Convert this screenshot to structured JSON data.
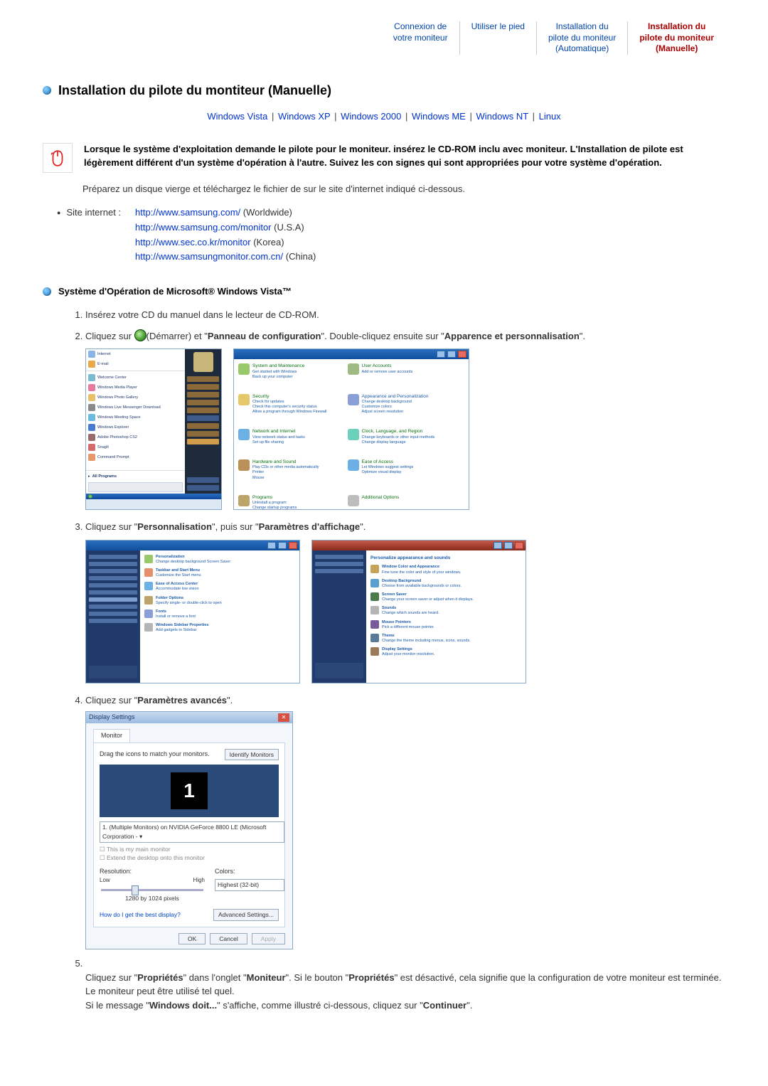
{
  "topnav": {
    "item1": "Connexion de\nvotre moniteur",
    "item2": "Utiliser le pied",
    "item3": "Installation du\npilote du moniteur\n(Automatique)",
    "item4": "Installation du\npilote du moniteur\n(Manuelle)"
  },
  "title": "Installation du pilote du montiteur (Manuelle)",
  "os_links": {
    "vista": "Windows Vista",
    "xp": "Windows XP",
    "w2000": "Windows 2000",
    "me": "Windows ME",
    "nt": "Windows NT",
    "linux": "Linux",
    "sep": "|"
  },
  "intro": "Lorsque le système d'exploitation demande le pilote pour le moniteur. insérez le CD-ROM inclu avec moniteur. L'Installation de pilote est légèrement différent d'un système d'opération à l'autre. Suivez les con signes qui sont appropriées pour votre système d'opération.",
  "prepare": "Préparez un disque vierge et téléchargez le fichier de sur le site d'internet indiqué ci-dessous.",
  "site_label": "Site internet :",
  "sites": {
    "worldwide_url": "http://www.samsung.com/",
    "worldwide_loc": " (Worldwide)",
    "usa_url": "http://www.samsung.com/monitor",
    "usa_loc": " (U.S.A)",
    "korea_url": "http://www.sec.co.kr/monitor",
    "korea_loc": " (Korea)",
    "china_url": "http://www.samsungmonitor.com.cn/",
    "china_loc": " (China)"
  },
  "vista_section_title": "Système d'Opération de Microsoft® Windows Vista™",
  "steps": {
    "s1": "Insérez votre CD du manuel dans le lecteur de CD-ROM.",
    "s2_pre": "Cliquez sur ",
    "s2_mid1": "(Démarrer) et \"",
    "s2_b1": "Panneau de configuration",
    "s2_mid2": "\". Double-cliquez ensuite sur \"",
    "s2_b2": "Apparence et personnalisation",
    "s2_end": "\".",
    "s3_pre": "Cliquez sur \"",
    "s3_b1": "Personnalisation",
    "s3_mid": "\", puis sur \"",
    "s3_b2": "Paramètres d'affichage",
    "s3_end": "\".",
    "s4_pre": "Cliquez sur \"",
    "s4_b1": "Paramètres avancés",
    "s4_end": "\".",
    "s5_pre": "Cliquez sur \"",
    "s5_b1": "Propriétés",
    "s5_mid1": "\" dans l'onglet \"",
    "s5_b2": "Moniteur",
    "s5_mid2": "\". Si le bouton \"",
    "s5_b3": "Propriétés",
    "s5_mid3": "\" est désactivé, cela signifie que la configuration de votre moniteur est terminée. Le moniteur peut être utilisé tel quel.\nSi le message \"",
    "s5_b4": "Windows doit...",
    "s5_mid4": "\" s'affiche, comme illustré ci-dessous, cliquez sur \"",
    "s5_b5": "Continuer",
    "s5_end": "\"."
  },
  "display_settings_window": {
    "title": "Display Settings",
    "tab": "Monitor",
    "drag_text": "Drag the icons to match your monitors.",
    "identify_btn": "Identify Monitors",
    "monitor_num": "1",
    "adapter_select": "1. (Multiple Monitors) on NVIDIA GeForce 8800 LE (Microsoft Corporation - ▾",
    "chk1": "This is my main monitor",
    "chk2": "Extend the desktop onto this monitor",
    "res_label": "Resolution:",
    "colors_label": "Colors:",
    "low": "Low",
    "high": "High",
    "res_value": "1280 by 1024 pixels",
    "color_value": "Highest (32-bit)",
    "help_link": "How do I get the best display?",
    "adv_btn": "Advanced Settings...",
    "ok": "OK",
    "cancel": "Cancel",
    "apply": "Apply"
  }
}
